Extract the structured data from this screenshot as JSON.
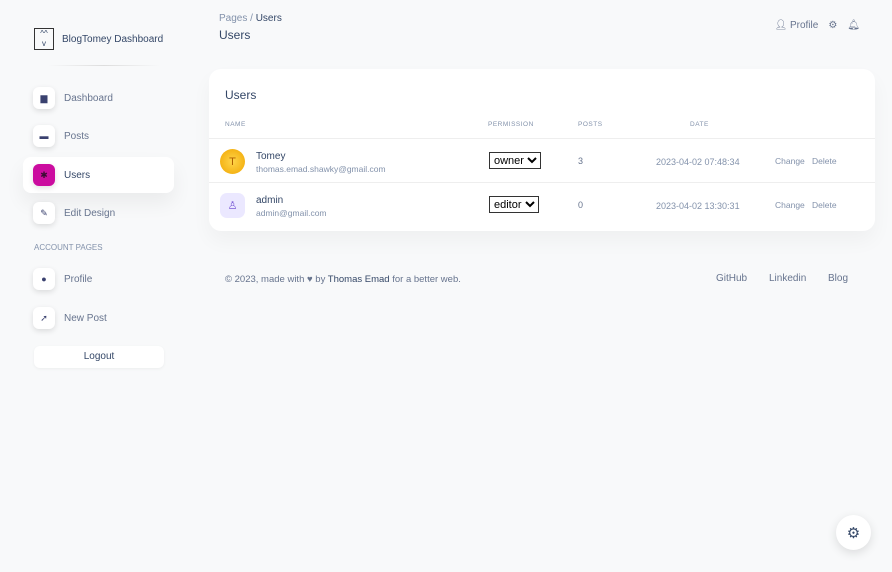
{
  "brand": "BlogTomey Dashboard",
  "sidebar": {
    "items": [
      {
        "label": "Dashboard"
      },
      {
        "label": "Posts"
      },
      {
        "label": "Users"
      },
      {
        "label": "Edit Design"
      }
    ],
    "section": "ACCOUNT PAGES",
    "account": [
      {
        "label": "Profile"
      },
      {
        "label": "New Post"
      }
    ],
    "logout": "Logout"
  },
  "header": {
    "crumb_root": "Pages",
    "crumb_sep": "/",
    "crumb_current": "Users",
    "title": "Users",
    "profile": "Profile"
  },
  "table": {
    "title": "Users",
    "columns": [
      "NAME",
      "PERMISSION",
      "POSTS",
      "DATE"
    ],
    "rows": [
      {
        "name": "Tomey",
        "email": "thomas.emad.shawky@gmail.com",
        "permission": "owner",
        "posts": "3",
        "date": "2023-04-02 07:48:34",
        "change": "Change",
        "delete": "Delete"
      },
      {
        "name": "admin",
        "email": "admin@gmail.com",
        "permission": "editor",
        "posts": "0",
        "date": "2023-04-02 13:30:31",
        "change": "Change",
        "delete": "Delete"
      }
    ]
  },
  "footer": {
    "pre": "© 2023, made with",
    "by": "by",
    "author": "Thomas Emad",
    "post": "for a better web.",
    "links": [
      "GitHub",
      "Linkedin",
      "Blog"
    ]
  },
  "colors": {
    "accent": "#cb0c9f"
  }
}
